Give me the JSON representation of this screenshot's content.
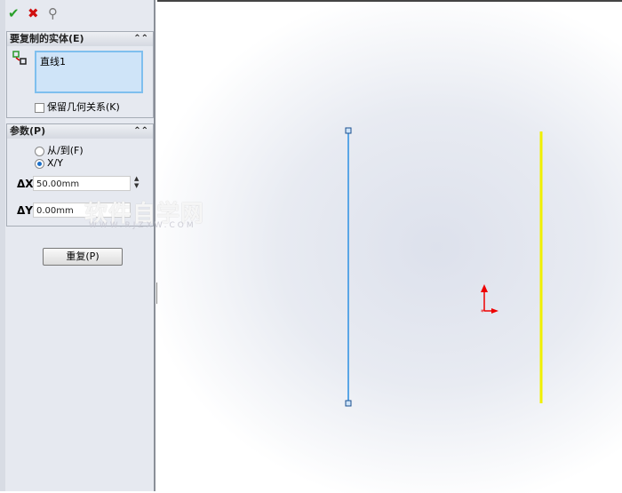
{
  "toolbar": {
    "ok": "✔",
    "cancel": "✖",
    "pin": "⚲"
  },
  "entities": {
    "title": "要复制的实体(E)",
    "item": "直线1",
    "keep_relations": "保留几何关系(K)",
    "keep_relations_checked": false
  },
  "params": {
    "title": "参数(P)",
    "option_from_to": "从/到(F)",
    "option_xy": "X/Y",
    "selected": "X/Y",
    "dx_label": "ΔX",
    "dx_value": "50.00mm",
    "dy_label": "ΔY",
    "dy_value": "0.00mm"
  },
  "repeat_button": "重复(P)",
  "watermark": {
    "text": "软件自学网",
    "url": "WWW.RJZXW.COM"
  },
  "colors": {
    "selected_line": "#5aa6e6",
    "preview_line": "#f0f000",
    "origin": "#e00000"
  }
}
